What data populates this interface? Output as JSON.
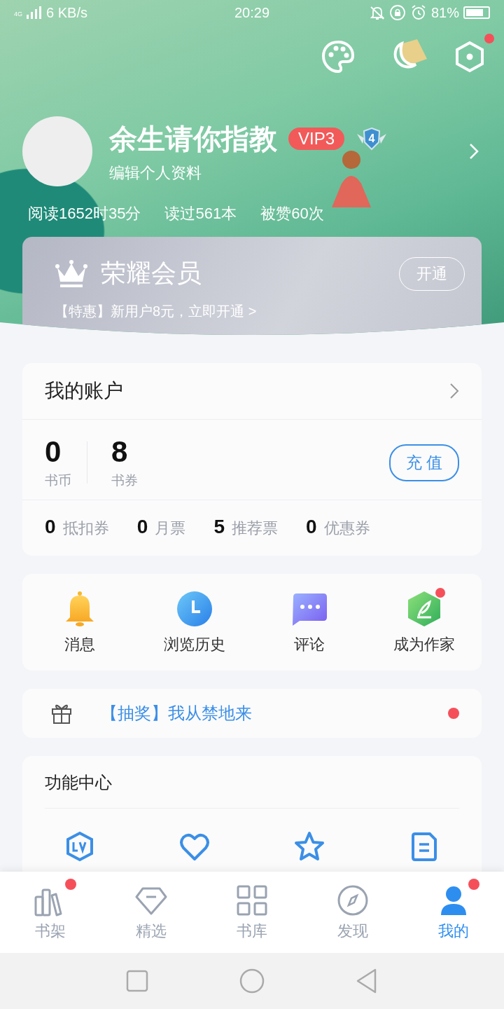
{
  "status_bar": {
    "network": "4G",
    "speed": "6 KB/s",
    "time": "20:29",
    "battery": "81%"
  },
  "header_actions": [
    {
      "kind": "palette",
      "badge": false
    },
    {
      "kind": "moon",
      "badge": false
    },
    {
      "kind": "settings",
      "badge": true
    }
  ],
  "profile": {
    "name": "余生请你指教",
    "vip": "VIP3",
    "level_badge": "4",
    "edit": "编辑个人资料"
  },
  "stats": [
    "阅读1652时35分",
    "读过561本",
    "被赞60次"
  ],
  "membership": {
    "title": "荣耀会员",
    "button": "开通",
    "promo": "【特惠】新用户8元，立即开通 >"
  },
  "account": {
    "title": "我的账户",
    "balances": [
      {
        "value": "0",
        "label": "书币"
      },
      {
        "value": "8",
        "label": "书券"
      }
    ],
    "recharge": "充 值",
    "tickets": [
      "**0** 抵扣券",
      "**0** 月票",
      "**5** 推荐票",
      "**0** 优惠券"
    ]
  },
  "shortcuts": [
    {
      "kind": "bell",
      "label": "消息",
      "badge": false
    },
    {
      "kind": "clock",
      "label": "浏览历史",
      "badge": false
    },
    {
      "kind": "chat",
      "label": "评论",
      "badge": false
    },
    {
      "kind": "pen",
      "label": "成为作家",
      "badge": true
    }
  ],
  "lottery": {
    "text": "【抽奖】我从禁地来",
    "badge": true
  },
  "features": {
    "title": "功能中心",
    "icons": [
      {
        "kind": "level"
      },
      {
        "kind": "heart"
      },
      {
        "kind": "star"
      },
      {
        "kind": "document"
      }
    ]
  },
  "tabs": [
    {
      "kind": "shelf",
      "label": "书架",
      "selected": false,
      "badge": true
    },
    {
      "kind": "diamond",
      "label": "精选",
      "selected": false,
      "badge": false
    },
    {
      "kind": "grid",
      "label": "书库",
      "selected": false,
      "badge": false
    },
    {
      "kind": "compass",
      "label": "发现",
      "selected": false,
      "badge": false
    },
    {
      "kind": "person",
      "label": "我的",
      "selected": true,
      "badge": true
    }
  ]
}
